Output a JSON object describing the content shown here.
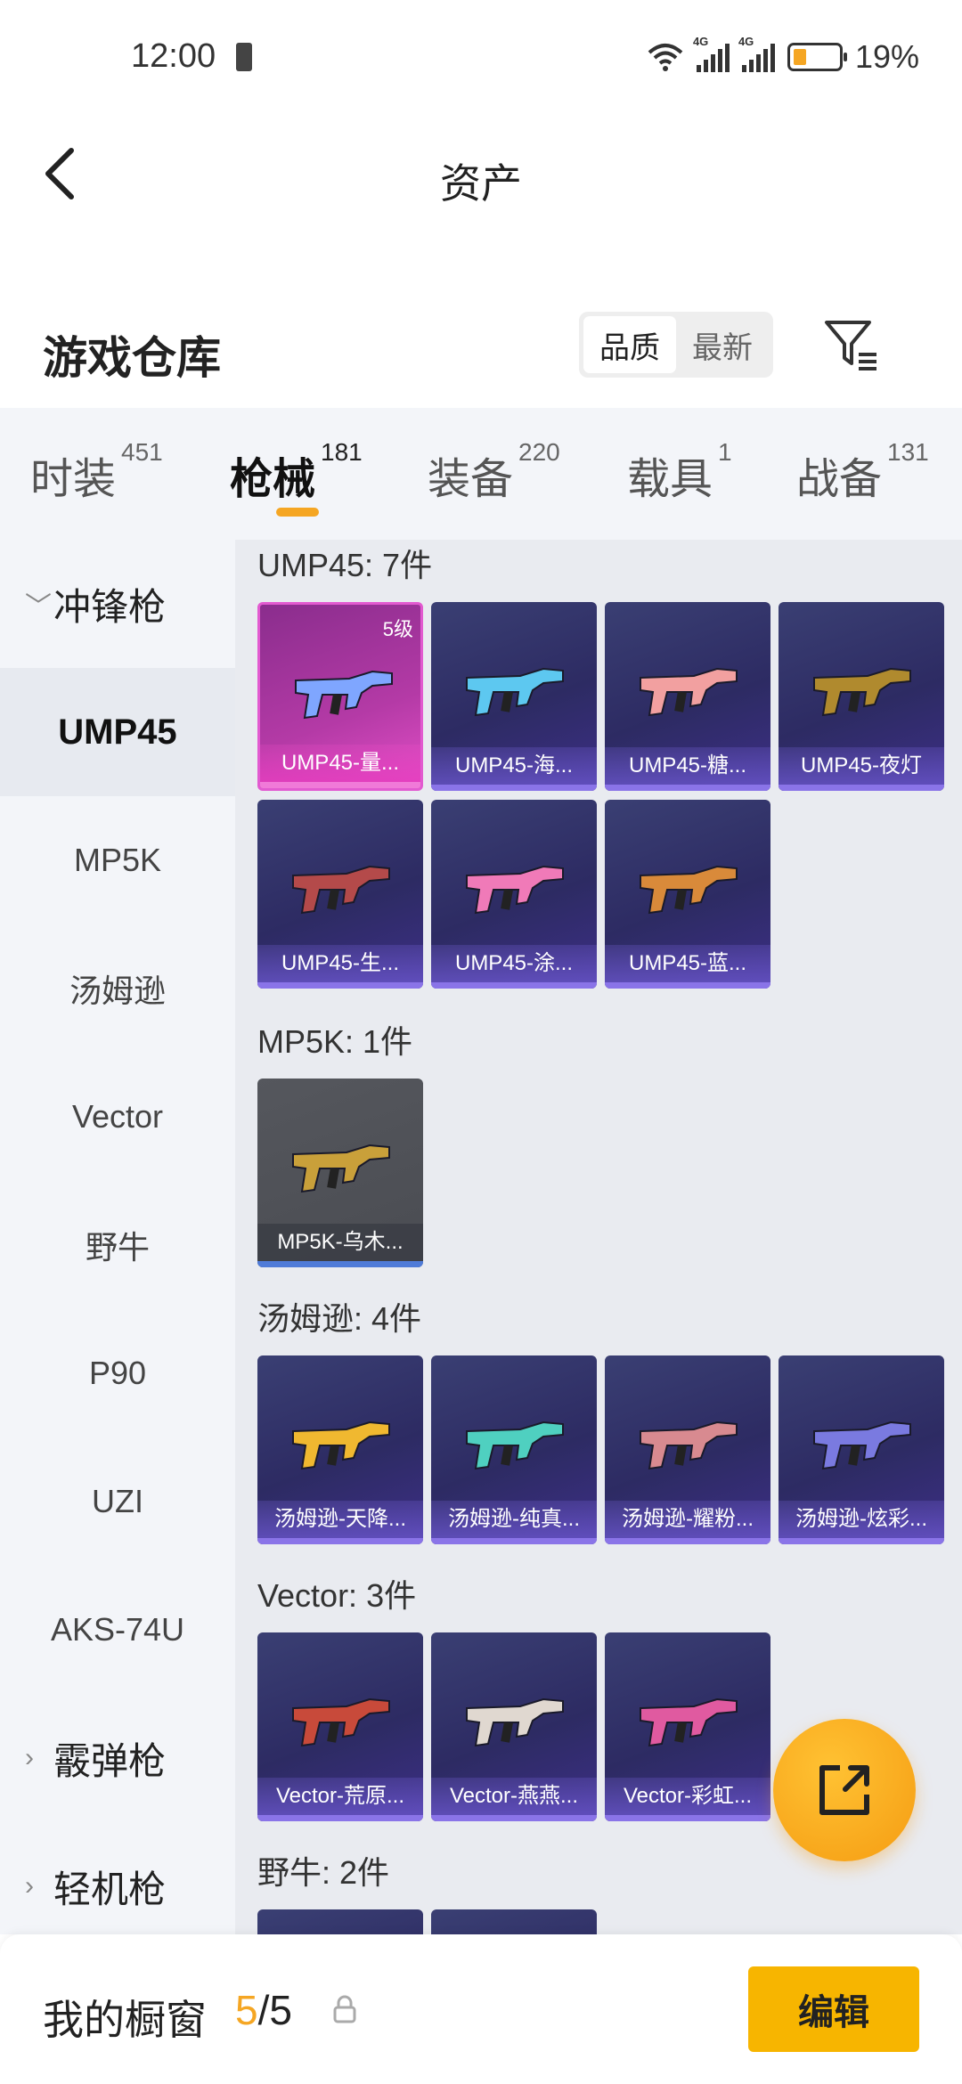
{
  "status_bar": {
    "time": "12:00",
    "battery_pct": "19%",
    "signal_a": "4G",
    "signal_b": "4G"
  },
  "header": {
    "title": "资产"
  },
  "warehouse": {
    "title": "游戏仓库",
    "sort_options": [
      "品质",
      "最新"
    ],
    "active_sort": "品质"
  },
  "tabs": [
    {
      "label": "时装",
      "count": "451"
    },
    {
      "label": "枪械",
      "count": "181"
    },
    {
      "label": "装备",
      "count": "220"
    },
    {
      "label": "载具",
      "count": "1"
    },
    {
      "label": "战备",
      "count": "131"
    }
  ],
  "active_tab": "枪械",
  "sidebar": {
    "groups": [
      "冲锋枪",
      "霰弹枪",
      "轻机枪"
    ],
    "items": [
      "UMP45",
      "MP5K",
      "汤姆逊",
      "Vector",
      "野牛",
      "P90",
      "UZI",
      "AKS-74U"
    ],
    "active_item": "UMP45"
  },
  "sections": [
    {
      "title": "UMP45: 7件",
      "items": [
        {
          "label": "UMP45-量...",
          "level": "5级",
          "style": "pink",
          "gun_color": "#7fa6ff"
        },
        {
          "label": "UMP45-海...",
          "style": "purple",
          "gun_color": "#5dc8f0"
        },
        {
          "label": "UMP45-糖...",
          "style": "purple",
          "gun_color": "#f2a0a0"
        },
        {
          "label": "UMP45-夜灯",
          "style": "purple",
          "gun_color": "#b08a2e"
        },
        {
          "label": "UMP45-生...",
          "style": "purple",
          "gun_color": "#b44a4a"
        },
        {
          "label": "UMP45-涂...",
          "style": "purple",
          "gun_color": "#f07ab8"
        },
        {
          "label": "UMP45-蓝...",
          "style": "purple",
          "gun_color": "#d98a3a"
        }
      ]
    },
    {
      "title": "MP5K: 1件",
      "items": [
        {
          "label": "MP5K-乌木...",
          "style": "grey",
          "gun_color": "#c9a03a"
        }
      ]
    },
    {
      "title": "汤姆逊: 4件",
      "items": [
        {
          "label": "汤姆逊-天降...",
          "style": "purple",
          "gun_color": "#f0b830"
        },
        {
          "label": "汤姆逊-纯真...",
          "style": "purple",
          "gun_color": "#4fd0c0"
        },
        {
          "label": "汤姆逊-耀粉...",
          "style": "purple",
          "gun_color": "#d88a90"
        },
        {
          "label": "汤姆逊-炫彩...",
          "style": "purple",
          "gun_color": "#7a7ae0"
        }
      ]
    },
    {
      "title": "Vector: 3件",
      "items": [
        {
          "label": "Vector-荒原...",
          "style": "purple",
          "gun_color": "#c84a3a"
        },
        {
          "label": "Vector-燕燕...",
          "style": "purple",
          "gun_color": "#e0d8d0"
        },
        {
          "label": "Vector-彩虹...",
          "style": "purple",
          "gun_color": "#e05aa0"
        }
      ]
    },
    {
      "title": "野牛: 2件",
      "items": [
        {
          "label": "",
          "style": "purple",
          "gun_color": "#8a8ad0"
        },
        {
          "label": "",
          "style": "purple",
          "gun_color": "#8a8ad0"
        }
      ]
    }
  ],
  "bottom": {
    "title": "我的橱窗",
    "current": "5",
    "separator": "/",
    "total": "5",
    "edit_label": "编辑"
  },
  "colors": {
    "accent": "#f5a623",
    "edit_button": "#f7b500",
    "card_purple": "#2d2b63",
    "card_pink": "#b43aa6"
  }
}
